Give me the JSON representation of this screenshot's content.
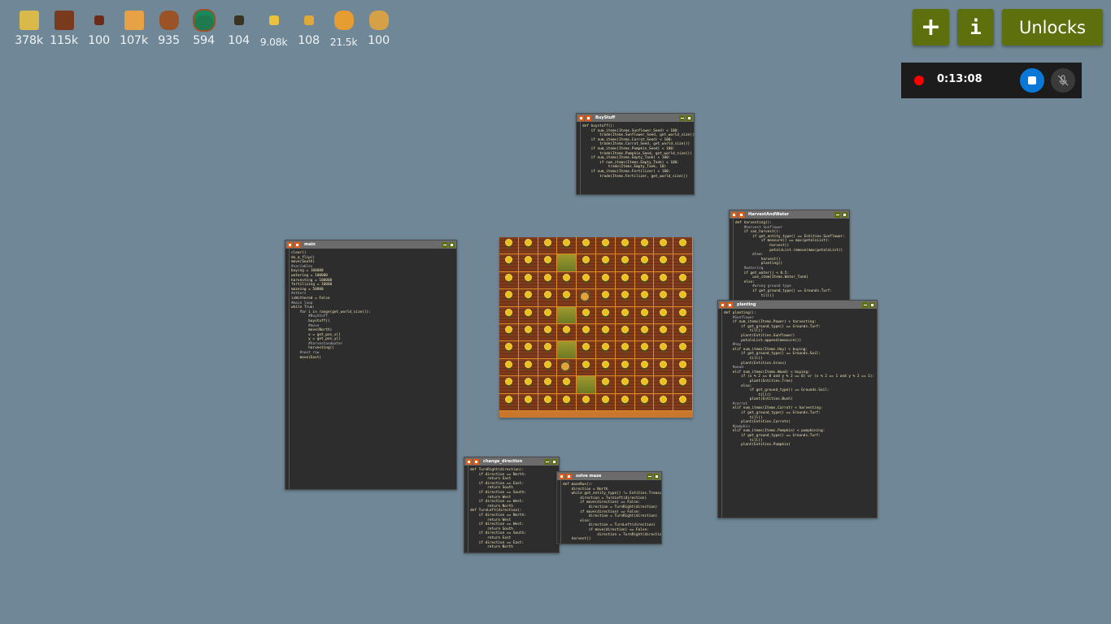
{
  "resources": [
    {
      "name": "hay",
      "value": "378k",
      "color": "#d9b94a"
    },
    {
      "name": "wood",
      "value": "115k",
      "color": "#7a3a1e"
    },
    {
      "name": "carrot-seeds",
      "value": "100",
      "color": "#6a2c18"
    },
    {
      "name": "carrot",
      "value": "107k",
      "color": "#e7a245"
    },
    {
      "name": "empty-tank",
      "value": "935",
      "color": "#9a5327"
    },
    {
      "name": "water-tank",
      "value": "594",
      "color": "#1f7a4f"
    },
    {
      "name": "fertilizer",
      "value": "104",
      "color": "#3a3320"
    },
    {
      "name": "power",
      "value": "9.08k",
      "color": "#e8c23a"
    },
    {
      "name": "sunflower-seeds",
      "value": "108",
      "color": "#e0a83a"
    },
    {
      "name": "pumpkin",
      "value": "21.5k",
      "color": "#e59c30"
    },
    {
      "name": "pumpkin-seeds",
      "value": "100",
      "color": "#d6a146"
    }
  ],
  "toolbar": {
    "add_label": "+",
    "info_label": "i",
    "unlocks_label": "Unlocks",
    "accent": "#5e700d"
  },
  "recorder": {
    "time": "0:13:08"
  },
  "windows": {
    "main": {
      "title": "main",
      "lines": [
        "clear()",
        "do_a_flip()",
        "move(South)",
        "",
        "#variables",
        "buying = 100000",
        "watering = 100000",
        "harvesting = 100000",
        "fertilizing = 10000",
        "mazeing = 50000",
        "",
        "#others",
        "isWithered = False",
        "",
        "#main loop",
        "while True:",
        "    for i in range(get_world_size()):",
        "        #BuyStuff",
        "        buystuff()",
        "        #move",
        "        move(North)",
        "        x = get_pos_x()",
        "        y = get_pos_y()",
        "        #harvestandwater",
        "        harvesting()",
        "    #next row",
        "    move(East)"
      ]
    },
    "buystuff": {
      "title": "BuyStuff",
      "lines": [
        "def buystuff():",
        "    if num_items(Items.Sunflower_Seed) < 100:",
        "        trade(Items.Sunflower_Seed, get_world_size())",
        "    if num_items(Items.Carrot_Seed) < 100:",
        "        trade(Items.Carrot_Seed, get_world_size())",
        "    if num_items(Items.Pumpkin_Seed) < 100:",
        "        trade(Items.Pumpkin_Seed, get_world_size())",
        "    if num_items(Items.Empty_Tank) < 100:",
        "        if num_items(Items.Empty_Tank) < 100:",
        "            trade(Items.Empty_Tank, 10)",
        "    if num_items(Items.Fertilizer) < 100:",
        "        trade(Items.Fertilizer, get_world_size())"
      ]
    },
    "harvest": {
      "title": "HarvestAndWater",
      "lines": [
        "def harvesting():",
        "    #harvest Sunflower",
        "    if can_harvest():",
        "        if get_entity_type() == Entities.Sunflower:",
        "            if measure() == max(petalsList):",
        "                harvest()",
        "                petalsList.remove(max(petalsList))",
        "        else:",
        "            harvest()",
        "            planting()",
        "    #watering",
        "    if get_water() < 0.5:",
        "        use_item(Items.Water_Tank)",
        "    else:",
        "        #wrong ground type",
        "        if get_ground_type() == Grounds.Turf:",
        "            till()"
      ]
    },
    "planting": {
      "title": "planting",
      "lines": [
        "def planting():",
        "    #Sunflower",
        "    if num_items(Items.Power) < harvesting:",
        "        if get_ground_type() == Grounds.Turf:",
        "            till()",
        "        plant(Entities.Sunflower)",
        "        petalsList.append(measure())",
        "    #hay",
        "    elif num_items(Items.Hay) < buying:",
        "        if get_ground_type() == Grounds.Soil:",
        "            till()",
        "        plant(Entities.Grass)",
        "    #wood",
        "    elif num_items(Items.Wood) < buying:",
        "        if (x % 2 == 0 and y % 2 == 0) or (x % 2 == 1 and y % 2 == 1):",
        "            plant(Entities.Tree)",
        "        else:",
        "            if get_ground_type() == Grounds.Soil:",
        "                till()",
        "            plant(Entities.Bush)",
        "    #carrot",
        "    elif num_items(Items.Carrot) < harvesting:",
        "        if get_ground_type() == Grounds.Turf:",
        "            till()",
        "        plant(Entities.Carrots)",
        "    #pumpkin",
        "    elif num_items(Items.Pumpkin) < pumpkining:",
        "        if get_ground_type() == Grounds.Turf:",
        "            till()",
        "        plant(Entities.Pumpkin)"
      ]
    },
    "change_direction": {
      "title": "change_direction",
      "lines": [
        "def TurnRight(direction):",
        "    if direction == North:",
        "        return East",
        "    if direction == East:",
        "        return South",
        "    if direction == South:",
        "        return West",
        "    if direction == West:",
        "        return North",
        "def TurnLeft(direction):",
        "    if direction == North:",
        "        return West",
        "    if direction == West:",
        "        return South",
        "    if direction == South:",
        "        return East",
        "    if direction == East:",
        "        return North"
      ]
    },
    "solve_maze": {
      "title": "solve maze",
      "lines": [
        "def mazeRun():",
        "    direction = North",
        "    while get_entity_type() != Entities.Treasure:",
        "        direction = TurnLeft(direction)",
        "        if move(direction) == False:",
        "            direction = TurnRight(direction)",
        "        if move(direction) == False:",
        "            direction = TurnRight(direction)",
        "        else:",
        "            direction = TurnLeft(direction)",
        "            if move(direction) == False:",
        "                direction = TurnRight(direction)",
        "    harvest()"
      ]
    }
  },
  "farm": {
    "size": 10,
    "crop": "sunflower",
    "grass_cells": [
      [
        1,
        3
      ],
      [
        4,
        3
      ],
      [
        6,
        3
      ],
      [
        8,
        4
      ]
    ],
    "drones": [
      [
        7,
        3
      ],
      [
        3,
        4
      ]
    ]
  }
}
